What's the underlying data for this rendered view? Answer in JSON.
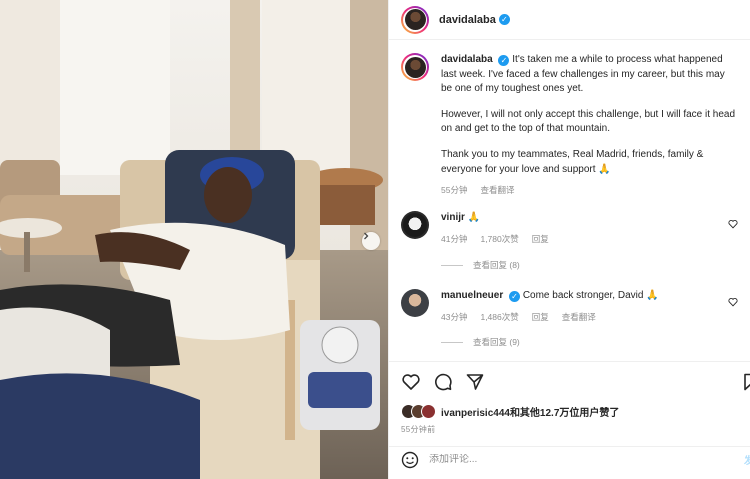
{
  "header": {
    "username": "davidalaba"
  },
  "caption": {
    "username": "davidalaba",
    "paragraphs": [
      "It's taken me a while to process what happened last week. I've faced a few challenges in my career, but this may be one of my toughest ones yet.",
      "However, I will not only accept this challenge, but I will face it head on and get to the top of that mountain.",
      "Thank you to my teammates, Real Madrid, friends, family & everyone for your love and support 🙏"
    ],
    "time": "55分钟",
    "translate": "查看翻译"
  },
  "comments": [
    {
      "username": "vinijr",
      "text": "🙏",
      "time": "41分钟",
      "likes": "1,780次赞",
      "reply": "回复",
      "view_replies": "查看回复 (8)"
    },
    {
      "username": "manuelneuer",
      "text": "Come back stronger, David 🙏",
      "time": "43分钟",
      "likes": "1,486次赞",
      "reply": "回复",
      "translate": "查看翻译",
      "view_replies": "查看回复 (9)"
    }
  ],
  "likes": {
    "user": "ivanperisic444",
    "rest": "和其他12.7万位用户赞了"
  },
  "post_time": "55分钟前",
  "add_comment": {
    "placeholder": "添加评论...",
    "post_label": "发布"
  },
  "icons": {
    "like": "heart-icon",
    "comment": "comment-icon",
    "share": "share-icon",
    "save": "bookmark-icon",
    "emoji": "emoji-icon",
    "next": "chevron-right-icon"
  },
  "colors": {
    "verified": "#1d9bf0",
    "muted": "#8e8e8e",
    "text": "#262626"
  }
}
